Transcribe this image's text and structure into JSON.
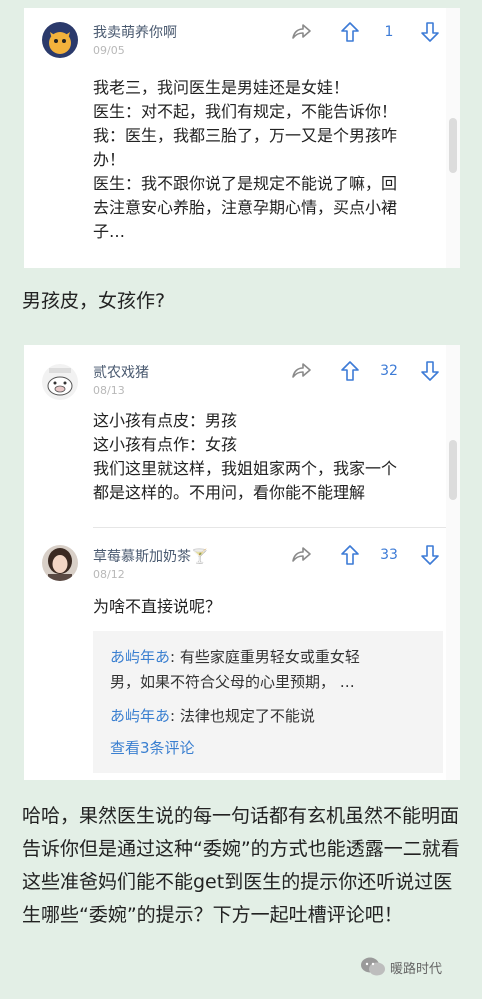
{
  "post1": {
    "username": "我卖萌养你啊",
    "date": "09/05",
    "likes": "1",
    "text": "我老三，我问医生是男娃还是女娃！\n医生：对不起，我们有规定，不能告诉你！\n我：医生，我都三胎了，万一又是个男孩咋\n办！\n医生：我不跟你说了是规定不能说了嘛，回\n去注意安心养胎，注意孕期心情，买点小裙\n子…"
  },
  "between_text": "男孩皮，女孩作?",
  "post2": {
    "username": "贰农戏猪",
    "date": "08/13",
    "likes": "32",
    "text": "这小孩有点皮：男孩\n这小孩有点作：女孩\n我们这里就这样，我姐姐家两个，我家一个\n都是这样的。不用问，看你能不能理解"
  },
  "post3": {
    "username": "草莓慕斯加奶茶🍸",
    "date": "08/12",
    "likes": "33",
    "text": "为啥不直接说呢？",
    "replies": [
      {
        "name": "あ屿年あ",
        "text": ": 有些家庭重男轻女或重女轻",
        "text2": "男，如果不符合父母的心里预期， …"
      },
      {
        "name": "あ屿年あ",
        "text": ": 法律也规定了不能说"
      }
    ],
    "view_more": "查看3条评论"
  },
  "footer_text": "哈哈，果然医生说的每一句话都有玄机虽然不能明面告诉你但是通过这种“委婉”的方式也能透露一二就看这些准爸妈们能不能get到医生的提示你还听说过医生哪些“委婉”的提示？下方一起吐槽评论吧！",
  "brand": "暖路时代",
  "colors": {
    "accent": "#3d7bd6",
    "background": "#e3efe6"
  }
}
